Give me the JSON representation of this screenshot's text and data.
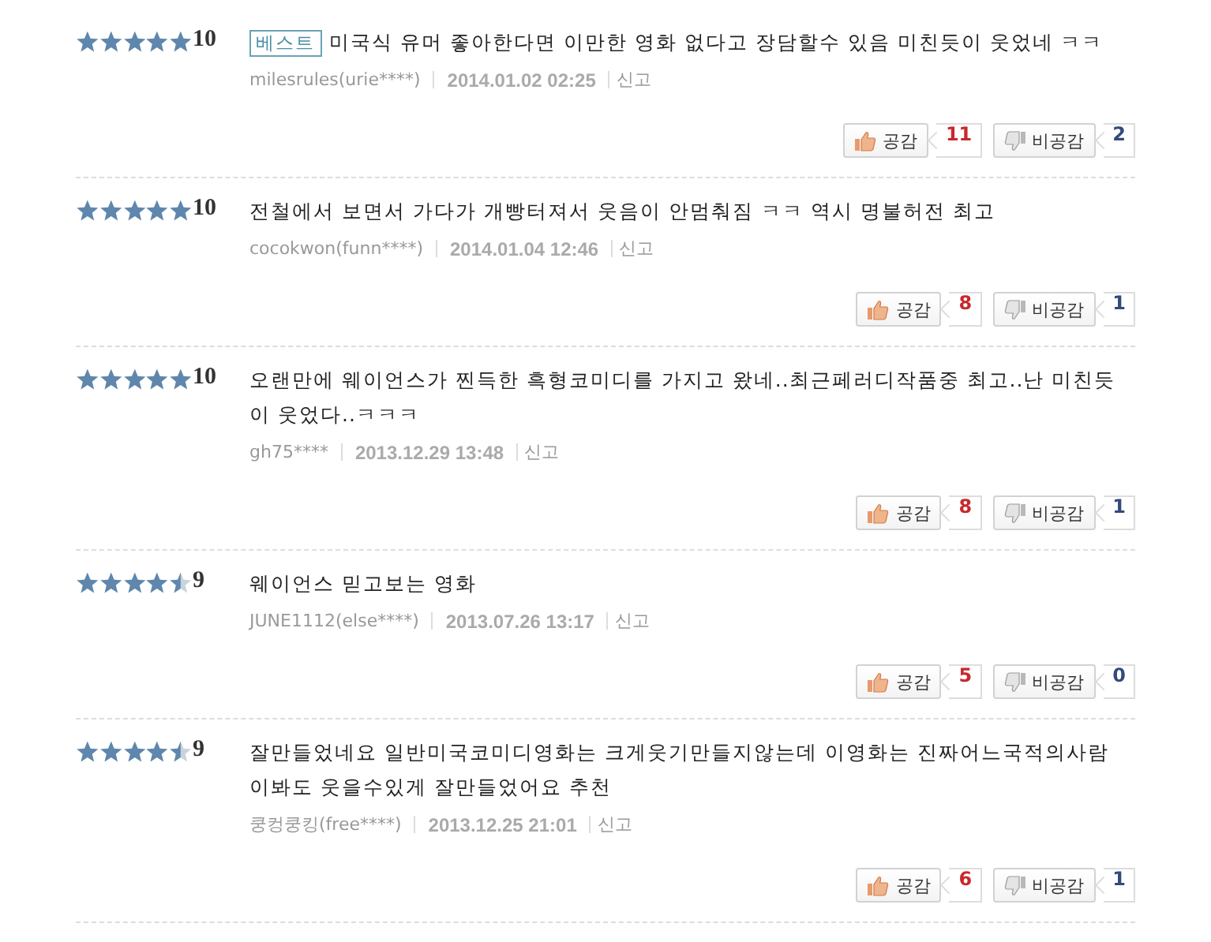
{
  "reviews": [
    {
      "stars": 5,
      "score": "10",
      "badge": "베스트",
      "text": "미국식 유머 좋아한다면 이만한 영화 없다고 장담할수 있음 미친듯이 웃었네 ㅋㅋ",
      "author": "milesrules(urie****)",
      "date": "2014.01.02 02:25",
      "report": "신고",
      "like_label": "공감",
      "likes": "11",
      "dislike_label": "비공감",
      "dislikes": "2"
    },
    {
      "stars": 5,
      "score": "10",
      "text": "전철에서 보면서 가다가 개빵터져서 웃음이 안멈춰짐 ㅋㅋ 역시 명불허전 최고",
      "author": "cocokwon(funn****)",
      "date": "2014.01.04 12:46",
      "report": "신고",
      "like_label": "공감",
      "likes": "8",
      "dislike_label": "비공감",
      "dislikes": "1"
    },
    {
      "stars": 5,
      "score": "10",
      "text": "오랜만에 웨이언스가 찐득한 흑형코미디를 가지고 왔네..최근페러디작품중 최고..난 미친듯이 웃었다..ㅋㅋㅋ",
      "author": "gh75****",
      "date": "2013.12.29 13:48",
      "report": "신고",
      "like_label": "공감",
      "likes": "8",
      "dislike_label": "비공감",
      "dislikes": "1"
    },
    {
      "stars": 4.5,
      "score": "9",
      "text": "웨이언스 믿고보는 영화",
      "author": "JUNE1112(else****)",
      "date": "2013.07.26 13:17",
      "report": "신고",
      "like_label": "공감",
      "likes": "5",
      "dislike_label": "비공감",
      "dislikes": "0"
    },
    {
      "stars": 4.5,
      "score": "9",
      "text": "잘만들었네요 일반미국코미디영화는 크게웃기만들지않는데 이영화는 진짜어느국적의사람이봐도 웃을수있게 잘만들었어요 추천",
      "author": "쿵컹쿵킹(free****)",
      "date": "2013.12.25 21:01",
      "report": "신고",
      "like_label": "공감",
      "likes": "6",
      "dislike_label": "비공감",
      "dislikes": "1"
    }
  ]
}
